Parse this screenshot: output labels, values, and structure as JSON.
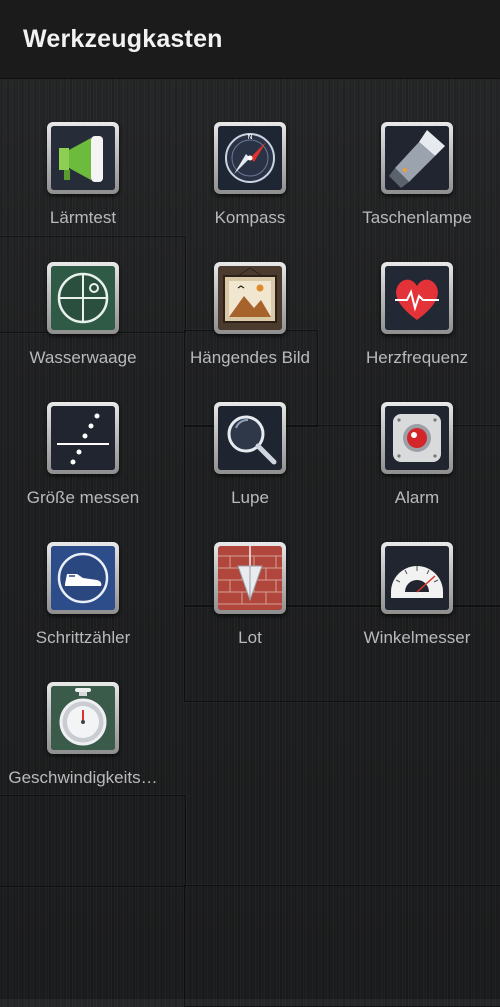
{
  "header": {
    "title": "Werkzeugkasten"
  },
  "tools": [
    {
      "label": "Lärmtest",
      "icon": "megaphone-icon"
    },
    {
      "label": "Kompass",
      "icon": "compass-icon"
    },
    {
      "label": "Taschenlampe",
      "icon": "flashlight-icon"
    },
    {
      "label": "Wasserwaage",
      "icon": "level-icon"
    },
    {
      "label": "Hängendes Bild",
      "icon": "hanging-picture-icon"
    },
    {
      "label": "Herzfrequenz",
      "icon": "heart-rate-icon"
    },
    {
      "label": "Größe messen",
      "icon": "measure-size-icon"
    },
    {
      "label": "Lupe",
      "icon": "magnifier-icon"
    },
    {
      "label": "Alarm",
      "icon": "alarm-icon"
    },
    {
      "label": "Schrittzähler",
      "icon": "pedometer-icon"
    },
    {
      "label": "Lot",
      "icon": "plumb-bob-icon"
    },
    {
      "label": "Winkelmesser",
      "icon": "protractor-icon"
    },
    {
      "label": "Geschwindigkeits…",
      "icon": "stopwatch-icon"
    }
  ],
  "colors": {
    "megaphone": "#6dbb3c",
    "compass_needle": "#e0312c",
    "level": "#2f5a46",
    "heart": "#e43239",
    "alarm_light": "#d3252a",
    "pedometer_bg": "#2c4c8a",
    "brick": "#b0463c",
    "stopwatch_bg": "#3a5a4a"
  }
}
